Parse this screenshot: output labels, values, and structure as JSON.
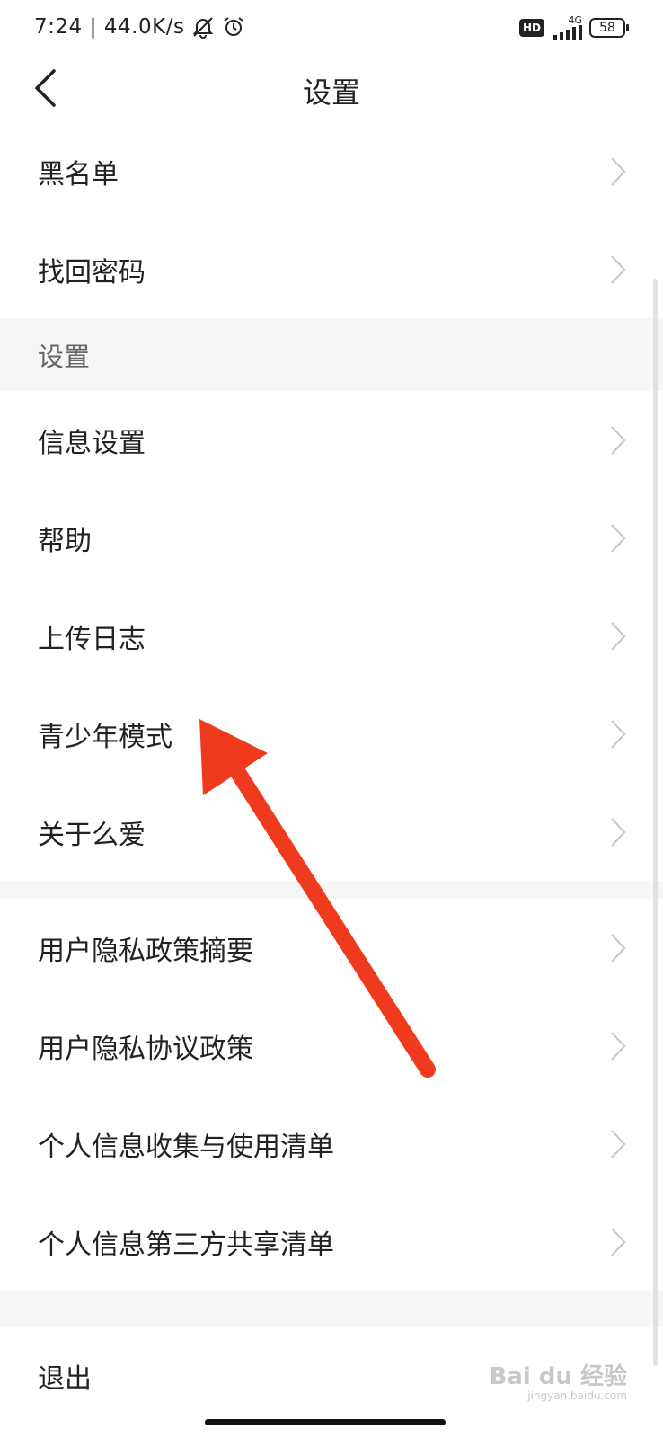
{
  "status_bar": {
    "time": "7:24",
    "network_speed": "44.0K/s",
    "network_type": "4G",
    "hd_label": "HD",
    "battery": "58",
    "icons": [
      "muted-bell-icon",
      "alarm-icon",
      "signal-icon",
      "battery-icon"
    ]
  },
  "navbar": {
    "title": "设置"
  },
  "items_top": [
    {
      "label": "黑名单"
    },
    {
      "label": "找回密码"
    }
  ],
  "section_header": "设置",
  "items_mid": [
    {
      "label": "信息设置"
    },
    {
      "label": "帮助"
    },
    {
      "label": "上传日志"
    },
    {
      "label": "青少年模式"
    },
    {
      "label": "关于么爱"
    }
  ],
  "items_privacy": [
    {
      "label": "用户隐私政策摘要"
    },
    {
      "label": "用户隐私协议政策"
    },
    {
      "label": "个人信息收集与使用清单"
    },
    {
      "label": "个人信息第三方共享清单"
    }
  ],
  "logout_label": "退出",
  "watermark": {
    "brand": "Bai du 经验",
    "url": "jingyan.baidu.com"
  },
  "colors": {
    "annotation_arrow": "#f03a1e",
    "section_bg": "#f6f6f6",
    "chevron": "#c4c4c4"
  }
}
